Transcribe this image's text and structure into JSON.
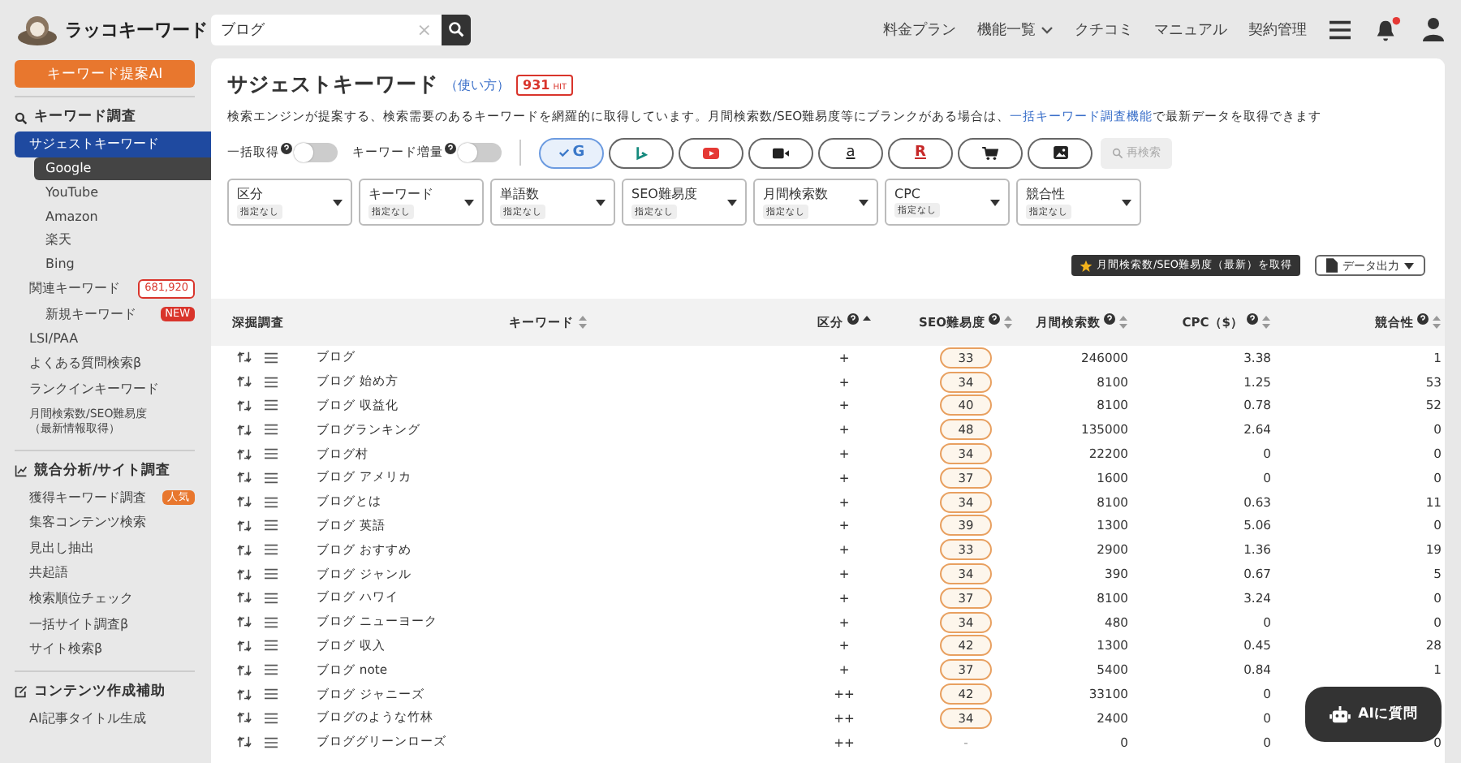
{
  "header": {
    "logo": "ラッコキーワード",
    "search": {
      "value": "ブログ",
      "clear": "×"
    },
    "nav": [
      {
        "label": "料金プラン",
        "dropdown": false
      },
      {
        "label": "機能一覧",
        "dropdown": true
      },
      {
        "label": "クチコミ",
        "dropdown": false
      },
      {
        "label": "マニュアル",
        "dropdown": false
      },
      {
        "label": "契約管理",
        "dropdown": false
      }
    ],
    "notification_unread": true
  },
  "sidebar": {
    "ai_button": "キーワード提案AI",
    "sections": [
      {
        "kind": "search",
        "title": "キーワード調査",
        "items": [
          {
            "label": "サジェストキーワード",
            "selected": true,
            "children": [
              {
                "label": "Google",
                "selected": true
              },
              {
                "label": "YouTube",
                "selected": false
              },
              {
                "label": "Amazon",
                "selected": false
              },
              {
                "label": "楽天",
                "selected": false
              },
              {
                "label": "Bing",
                "selected": false
              }
            ]
          },
          {
            "label": "関連キーワード",
            "selected": false,
            "badge": {
              "text": "681,920",
              "kind": "outline"
            },
            "children": [
              {
                "label": "新規キーワード",
                "selected": false,
                "badge": {
                  "text": "NEW",
                  "kind": "red"
                }
              }
            ]
          },
          {
            "label": "LSI/PAA",
            "selected": false
          },
          {
            "label": "よくある質問検索β",
            "selected": false
          },
          {
            "label": "ランクインキーワード",
            "selected": false
          },
          {
            "label": "月間検索数/SEO難易度",
            "note": "（最新情報取得）",
            "selected": false
          }
        ]
      },
      {
        "kind": "chart",
        "title": "競合分析/サイト調査",
        "items": [
          {
            "label": "獲得キーワード調査",
            "selected": false,
            "badge": {
              "text": "人気",
              "kind": "orange"
            }
          },
          {
            "label": "集客コンテンツ検索",
            "selected": false
          },
          {
            "label": "見出し抽出",
            "selected": false
          },
          {
            "label": "共起語",
            "selected": false
          },
          {
            "label": "検索順位チェック",
            "selected": false
          },
          {
            "label": "一括サイト調査β",
            "selected": false
          },
          {
            "label": "サイト検索β",
            "selected": false
          }
        ]
      },
      {
        "kind": "edit",
        "title": "コンテンツ作成補助",
        "items": [
          {
            "label": "AI記事タイトル生成",
            "selected": false
          }
        ]
      }
    ]
  },
  "main": {
    "title": "サジェストキーワード",
    "help_link": "（使い方）",
    "hits": "931",
    "hits_unit": "HIT",
    "description": {
      "before": "検索エンジンが提案する、検索需要のあるキーワードを網羅的に取得しています。月間検索数/SEO難易度等にブランクがある場合は、",
      "link": "一括キーワード調査機能",
      "after": "で最新データを取得できます"
    },
    "toggles": [
      {
        "label": "一括取得",
        "on": false
      },
      {
        "label": "キーワード増量",
        "on": false
      }
    ],
    "engines": [
      {
        "kind": "google",
        "label": "G",
        "selected": true
      },
      {
        "kind": "bing",
        "selected": false
      },
      {
        "kind": "youtube",
        "selected": false
      },
      {
        "kind": "video",
        "selected": false
      },
      {
        "kind": "amazon",
        "label": "a",
        "selected": false
      },
      {
        "kind": "rakuten",
        "label": "R",
        "selected": false
      },
      {
        "kind": "shopping",
        "selected": false
      },
      {
        "kind": "image",
        "selected": false
      }
    ],
    "research_button": {
      "label": "再検索",
      "disabled": true
    },
    "filters": [
      {
        "label": "区分",
        "value": "指定なし"
      },
      {
        "label": "キーワード",
        "value": "指定なし"
      },
      {
        "label": "単語数",
        "value": "指定なし"
      },
      {
        "label": "SEO難易度",
        "value": "指定なし"
      },
      {
        "label": "月間検索数",
        "value": "指定なし"
      },
      {
        "label": "CPC",
        "value": "指定なし"
      },
      {
        "label": "競合性",
        "value": "指定なし"
      }
    ],
    "fetch_button": "月間検索数/SEO難易度（最新）を取得",
    "export_button": "データ出力",
    "table": {
      "columns": [
        {
          "label": "深掘調査",
          "help": false,
          "sortable": false
        },
        {
          "label": "キーワード",
          "help": false,
          "sorted": false,
          "sortable": true
        },
        {
          "label": "区分",
          "help": true,
          "sorted": true,
          "sortable": true
        },
        {
          "label": "SEO難易度",
          "help": true,
          "sorted": false,
          "sortable": true
        },
        {
          "label": "月間検索数",
          "help": true,
          "sorted": false,
          "sortable": true
        },
        {
          "label": "CPC（$）",
          "help": true,
          "sorted": false,
          "sortable": true
        },
        {
          "label": "競合性",
          "help": true,
          "sorted": false,
          "sortable": true
        }
      ],
      "rows": [
        {
          "keyword": "ブログ",
          "type": "+",
          "seo": "33",
          "kind": "badge",
          "volume": "246000",
          "cpc": "3.38",
          "competition": "1"
        },
        {
          "keyword": "ブログ 始め方",
          "type": "+",
          "seo": "34",
          "kind": "badge",
          "volume": "8100",
          "cpc": "1.25",
          "competition": "53"
        },
        {
          "keyword": "ブログ 収益化",
          "type": "+",
          "seo": "40",
          "kind": "badge",
          "volume": "8100",
          "cpc": "0.78",
          "competition": "52"
        },
        {
          "keyword": "ブログランキング",
          "type": "+",
          "seo": "48",
          "kind": "badge",
          "volume": "135000",
          "cpc": "2.64",
          "competition": "0"
        },
        {
          "keyword": "ブログ村",
          "type": "+",
          "seo": "34",
          "kind": "badge",
          "volume": "22200",
          "cpc": "0",
          "competition": "0"
        },
        {
          "keyword": "ブログ アメリカ",
          "type": "+",
          "seo": "37",
          "kind": "badge",
          "volume": "1600",
          "cpc": "0",
          "competition": "0"
        },
        {
          "keyword": "ブログとは",
          "type": "+",
          "seo": "34",
          "kind": "badge",
          "volume": "8100",
          "cpc": "0.63",
          "competition": "11"
        },
        {
          "keyword": "ブログ 英語",
          "type": "+",
          "seo": "39",
          "kind": "badge",
          "volume": "1300",
          "cpc": "5.06",
          "competition": "0"
        },
        {
          "keyword": "ブログ おすすめ",
          "type": "+",
          "seo": "33",
          "kind": "badge",
          "volume": "2900",
          "cpc": "1.36",
          "competition": "19"
        },
        {
          "keyword": "ブログ ジャンル",
          "type": "+",
          "seo": "34",
          "kind": "badge",
          "volume": "390",
          "cpc": "0.67",
          "competition": "5"
        },
        {
          "keyword": "ブログ ハワイ",
          "type": "+",
          "seo": "37",
          "kind": "badge",
          "volume": "8100",
          "cpc": "3.24",
          "competition": "0"
        },
        {
          "keyword": "ブログ ニューヨーク",
          "type": "+",
          "seo": "34",
          "kind": "badge",
          "volume": "480",
          "cpc": "0",
          "competition": "0"
        },
        {
          "keyword": "ブログ 収入",
          "type": "+",
          "seo": "42",
          "kind": "badge",
          "volume": "1300",
          "cpc": "0.45",
          "competition": "28"
        },
        {
          "keyword": "ブログ note",
          "type": "+",
          "seo": "37",
          "kind": "badge",
          "volume": "5400",
          "cpc": "0.84",
          "competition": "1"
        },
        {
          "keyword": "ブログ ジャニーズ",
          "type": "++",
          "seo": "42",
          "kind": "badge",
          "volume": "33100",
          "cpc": "0"
        },
        {
          "keyword": "ブログのような竹林",
          "type": "++",
          "seo": "34",
          "kind": "badge",
          "volume": "2400",
          "cpc": "0"
        },
        {
          "keyword": "ブロググリーンローズ",
          "type": "++",
          "seo": "-",
          "kind": "plain",
          "volume": "0",
          "cpc": "0",
          "competition": "0"
        }
      ]
    }
  },
  "ai_chat_button": "AIに質問"
}
